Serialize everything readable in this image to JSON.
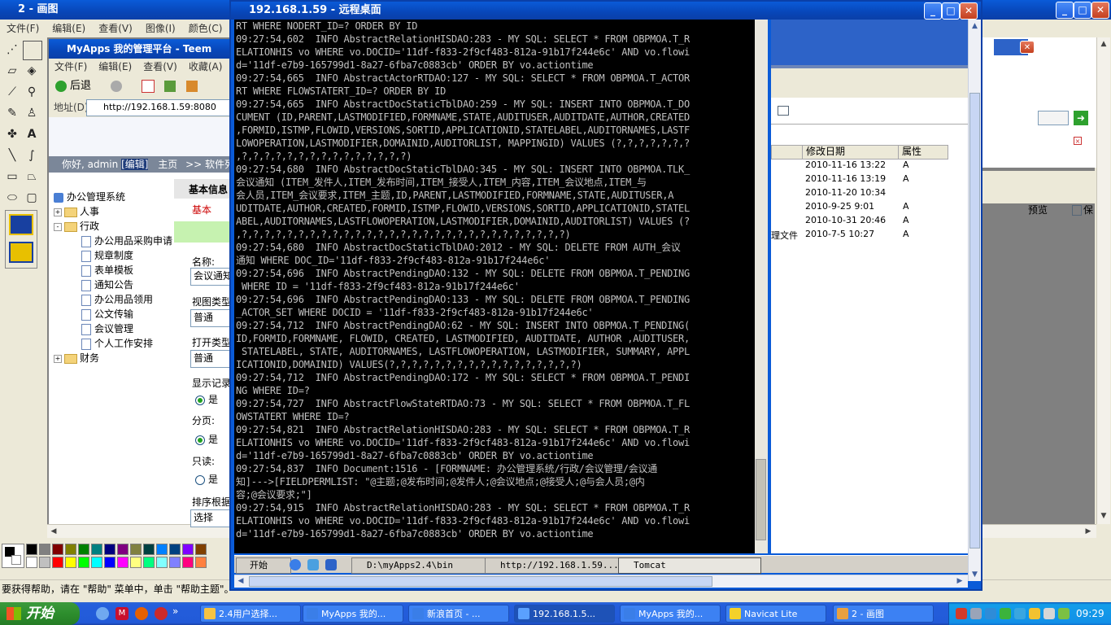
{
  "paint": {
    "title": "2 - 画图",
    "menu": [
      "文件(F)",
      "编辑(E)",
      "查看(V)",
      "图像(I)",
      "颜色(C)",
      "帮"
    ],
    "status": "要获得帮助，请在 \"帮助\" 菜单中，单击 \"帮助主题\"。",
    "palette_top": [
      "#000000",
      "#808080",
      "#800000",
      "#808000",
      "#008000",
      "#008080",
      "#000080",
      "#800080",
      "#808040",
      "#004040",
      "#0080ff",
      "#004080",
      "#8000ff",
      "#804000"
    ],
    "palette_bottom": [
      "#ffffff",
      "#c0c0c0",
      "#ff0000",
      "#ffff00",
      "#00ff00",
      "#00ffff",
      "#0000ff",
      "#ff00ff",
      "#ffff80",
      "#00ff80",
      "#80ffff",
      "#8080ff",
      "#ff0080",
      "#ff8040"
    ]
  },
  "ie": {
    "title": "MyApps 我的管理平台 - Teem",
    "menu": [
      "文件(F)",
      "编辑(E)",
      "查看(V)",
      "收藏(A)"
    ],
    "back_label": "后退",
    "address_label": "地址(D)",
    "address_value": "http://192.168.1.59:8080",
    "greeting": "你好, admin",
    "edit_link": "[编辑]",
    "home_link": "主页",
    "software_link": ">> 软件列表",
    "tree_root": "办公管理系统",
    "tree": [
      {
        "label": "人事",
        "type": "folder",
        "expand": "+"
      },
      {
        "label": "行政",
        "type": "folder",
        "expand": "-"
      },
      {
        "label": "办公用品采购申请",
        "type": "doc"
      },
      {
        "label": "规章制度",
        "type": "doc"
      },
      {
        "label": "表单模板",
        "type": "doc"
      },
      {
        "label": "通知公告",
        "type": "doc"
      },
      {
        "label": "办公用品领用",
        "type": "doc"
      },
      {
        "label": "公文传输",
        "type": "doc"
      },
      {
        "label": "会议管理",
        "type": "doc"
      },
      {
        "label": "个人工作安排",
        "type": "doc"
      },
      {
        "label": "财务",
        "type": "folder",
        "expand": "+"
      }
    ],
    "form": {
      "tab_basic_info": "基本信息",
      "tab_basic": "基本",
      "name_label": "名称:",
      "name_value": "会议通知",
      "view_type_label": "视图类型",
      "view_type_value": "普通",
      "open_type_label": "打开类型",
      "open_type_value": "普通",
      "show_records_label": "显示记录",
      "yes": "是",
      "paging_label": "分页:",
      "readonly_label": "只读:",
      "sort_label": "排序根据",
      "sort_value": "选择"
    }
  },
  "rdp": {
    "title": "192.168.1.59 - 远程桌面",
    "console_lines": [
      "RT WHERE NODERT_ID=? ORDER BY ID",
      "09:27:54,602  INFO AbstractRelationHISDAO:283 - MY SQL: SELECT * FROM OBPMOA.T_R",
      "ELATIONHIS vo WHERE vo.DOCID='11df-f833-2f9cf483-812a-91b17f244e6c' AND vo.flowi",
      "d='11df-e7b9-165799d1-8a27-6fba7c0883cb' ORDER BY vo.actiontime",
      "09:27:54,665  INFO AbstractActorRTDAO:127 - MY SQL: SELECT * FROM OBPMOA.T_ACTOR",
      "RT WHERE FLOWSTATERT_ID=? ORDER BY ID",
      "09:27:54,665  INFO AbstractDocStaticTblDAO:259 - MY SQL: INSERT INTO OBPMOA.T_DO",
      "CUMENT (ID,PARENT,LASTMODIFIED,FORMNAME,STATE,AUDITUSER,AUDITDATE,AUTHOR,CREATED",
      ",FORMID,ISTMP,FLOWID,VERSIONS,SORTID,APPLICATIONID,STATELABEL,AUDITORNAMES,LASTF",
      "LOWOPERATION,LASTMODIFIER,DOMAINID,AUDITORLIST, MAPPINGID) VALUES (?,?,?,?,?,?,?",
      ",?,?,?,?,?,?,?,?,?,?,?,?,?,?,?)",
      "09:27:54,680  INFO AbstractDocStaticTblDAO:345 - MY SQL: INSERT INTO OBPMOA.TLK_",
      "会议通知 (ITEM_发件人,ITEM_发布时间,ITEM_接受人,ITEM_内容,ITEM_会议地点,ITEM_与",
      "会人员,ITEM_会议要求,ITEM_主题,ID,PARENT,LASTMODIFIED,FORMNAME,STATE,AUDITUSER,A",
      "UDITDATE,AUTHOR,CREATED,FORMID,ISTMP,FLOWID,VERSIONS,SORTID,APPLICATIONID,STATEL",
      "ABEL,AUDITORNAMES,LASTFLOWOPERATION,LASTMODIFIER,DOMAINID,AUDITORLIST) VALUES (?",
      ",?,?,?,?,?,?,?,?,?,?,?,?,?,?,?,?,?,?,?,?,?,?,?,?,?,?,?,?,?)",
      "09:27:54,680  INFO AbstractDocStaticTblDAO:2012 - MY SQL: DELETE FROM AUTH_会议",
      "通知 WHERE DOC_ID='11df-f833-2f9cf483-812a-91b17f244e6c'",
      "09:27:54,696  INFO AbstractPendingDAO:132 - MY SQL: DELETE FROM OBPMOA.T_PENDING",
      " WHERE ID = '11df-f833-2f9cf483-812a-91b17f244e6c'",
      "09:27:54,696  INFO AbstractPendingDAO:133 - MY SQL: DELETE FROM OBPMOA.T_PENDING",
      "_ACTOR_SET WHERE DOCID = '11df-f833-2f9cf483-812a-91b17f244e6c'",
      "09:27:54,712  INFO AbstractPendingDAO:62 - MY SQL: INSERT INTO OBPMOA.T_PENDING(",
      "ID,FORMID,FORMNAME, FLOWID, CREATED, LASTMODIFIED, AUDITDATE, AUTHOR ,AUDITUSER,",
      " STATELABEL, STATE, AUDITORNAMES, LASTFLOWOPERATION, LASTMODIFIER, SUMMARY, APPL",
      "ICATIONID,DOMAINID) VALUES(?,?,?,?,?,?,?,?,?,?,?,?,?,?,?,?,?)",
      "09:27:54,712  INFO AbstractPendingDAO:172 - MY SQL: SELECT * FROM OBPMOA.T_PENDI",
      "NG WHERE ID=?",
      "09:27:54,727  INFO AbstractFlowStateRTDAO:73 - MY SQL: SELECT * FROM OBPMOA.T_FL",
      "OWSTATERT WHERE ID=?",
      "09:27:54,821  INFO AbstractRelationHISDAO:283 - MY SQL: SELECT * FROM OBPMOA.T_R",
      "ELATIONHIS vo WHERE vo.DOCID='11df-f833-2f9cf483-812a-91b17f244e6c' AND vo.flowi",
      "d='11df-e7b9-165799d1-8a27-6fba7c0883cb' ORDER BY vo.actiontime",
      "09:27:54,837  INFO Document:1516 - [FORMNAME: 办公管理系统/行政/会议管理/会议通",
      "知]--->[FIELDPERMLIST: \"@主题;@发布时间;@发件人;@会议地点;@接受人;@与会人员;@内",
      "容;@会议要求;\"]",
      "09:27:54,915  INFO AbstractRelationHISDAO:283 - MY SQL: SELECT * FROM OBPMOA.T_R",
      "ELATIONHIS vo WHERE vo.DOCID='11df-f833-2f9cf483-812a-91b17f244e6c' AND vo.flowi",
      "d='11df-e7b9-165799d1-8a27-6fba7c0883cb' ORDER BY vo.actiontime"
    ],
    "explorer": {
      "col_modified": "修改日期",
      "col_attr": "属性",
      "rows": [
        {
          "name": "",
          "date": "2010-11-16 13:22",
          "attr": "A"
        },
        {
          "name": "",
          "date": "2010-11-16 13:19",
          "attr": "A"
        },
        {
          "name": "",
          "date": "2010-11-20 10:34",
          "attr": ""
        },
        {
          "name": "",
          "date": "2010-9-25 9:01",
          "attr": "A"
        },
        {
          "name": "",
          "date": "2010-10-31 20:46",
          "attr": "A"
        },
        {
          "name": "理文件",
          "date": "2010-7-5 10:27",
          "attr": "A"
        }
      ],
      "preview_label": "预览",
      "save_label": "保"
    },
    "remote_taskbar": {
      "start": "开始",
      "items": [
        "D:\\myApps2.4\\bin",
        "http://192.168.1.59...",
        "Tomcat"
      ]
    }
  },
  "taskbar": {
    "start_label": "开始",
    "tasks": [
      {
        "label": "2.4用户选择...",
        "color": "#f6c342"
      },
      {
        "label": "MyApps 我的...",
        "color": "#3a7ee8"
      },
      {
        "label": "新浪首页 - ...",
        "color": "#3a7ee8"
      },
      {
        "label": "192.168.1.5...",
        "color": "#5aa0ff",
        "active": true
      },
      {
        "label": "MyApps 我的...",
        "color": "#3a7ee8"
      },
      {
        "label": "Navicat Lite",
        "color": "#f4d12a"
      },
      {
        "label": "2 - 画图",
        "color": "#e8a040"
      }
    ],
    "clock": "09:29"
  }
}
